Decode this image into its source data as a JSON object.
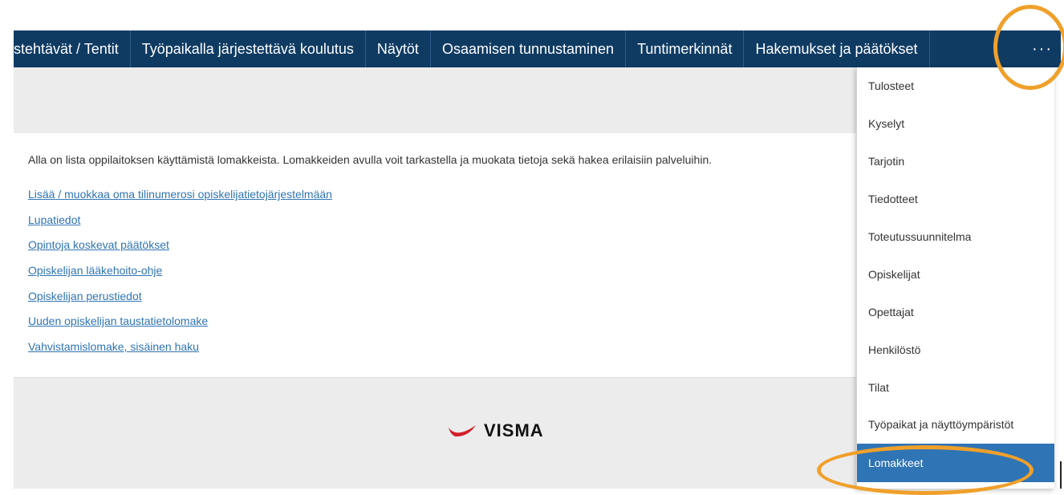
{
  "nav": {
    "items": [
      "stehtävät / Tentit",
      "Työpaikalla järjestettävä koulutus",
      "Näytöt",
      "Osaamisen tunnustaminen",
      "Tuntimerkinnät",
      "Hakemukset ja päätökset"
    ],
    "more_label": "···"
  },
  "content": {
    "intro": "Alla on lista oppilaitoksen käyttämistä lomakkeista. Lomakkeiden avulla voit tarkastella ja muokata tietoja sekä hakea erilaisiin palveluihin.",
    "links": [
      "Lisää / muokkaa oma tilinumerosi opiskelijatietojärjestelmään",
      "Lupatiedot",
      "Opintoja koskevat päätökset",
      "Opiskelijan lääkehoito-ohje",
      "Opiskelijan perustiedot",
      "Uuden opiskelijan taustatietolomake",
      "Vahvistamislomake, sisäinen haku"
    ]
  },
  "footer": {
    "logo_text": "VISMA"
  },
  "menu": {
    "items": [
      "Tulosteet",
      "Kyselyt",
      "Tarjotin",
      "Tiedotteet",
      "Toteutussuunnitelma",
      "Opiskelijat",
      "Opettajat",
      "Henkilöstö",
      "Tilat",
      "Työpaikat ja näyttöympäristöt",
      "Lomakkeet"
    ],
    "active_index": 10
  },
  "colors": {
    "navbar": "#0f3b63",
    "link": "#2f74b5",
    "active_menu": "#2f74b5",
    "annotation": "#f0a02a",
    "visma_red": "#d4202a"
  }
}
